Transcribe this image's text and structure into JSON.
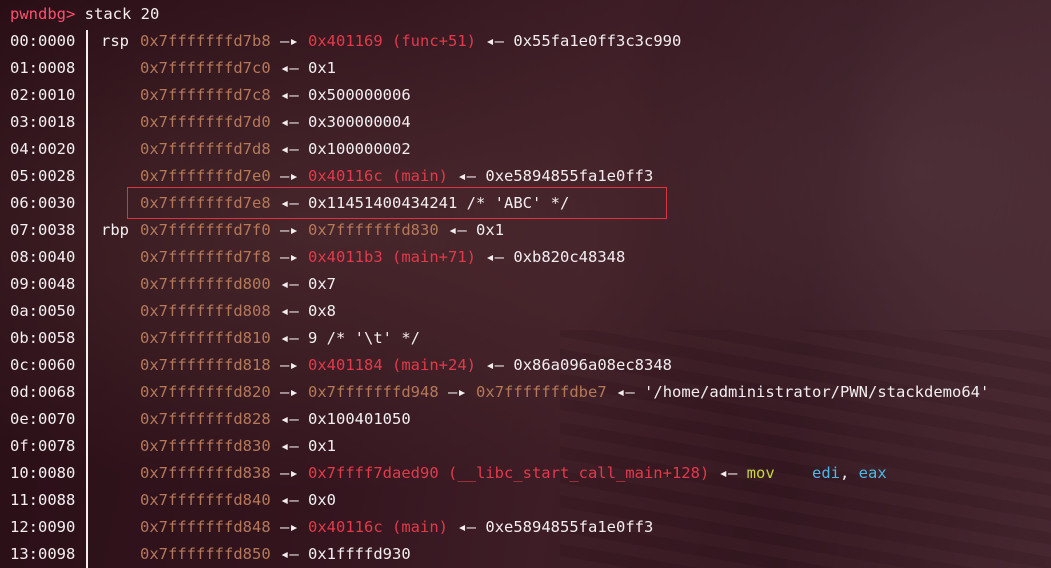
{
  "prompt": "pwndbg>",
  "command": "stack 20",
  "arrows": {
    "right": "—▸",
    "left": "◂—"
  },
  "rows": [
    {
      "idx": "00:0000",
      "reg": "rsp",
      "addr": "0x7fffffffd7b8",
      "a1": "—▸",
      "t1": "0x401169 (func+51)",
      "t1c": "code",
      "a2": "◂—",
      "t2": "0x55fa1e0ff3c3c990",
      "t2c": "val"
    },
    {
      "idx": "01:0008",
      "reg": "",
      "addr": "0x7fffffffd7c0",
      "a1": "◂—",
      "t1": "0x1",
      "t1c": "val"
    },
    {
      "idx": "02:0010",
      "reg": "",
      "addr": "0x7fffffffd7c8",
      "a1": "◂—",
      "t1": "0x500000006",
      "t1c": "val"
    },
    {
      "idx": "03:0018",
      "reg": "",
      "addr": "0x7fffffffd7d0",
      "a1": "◂—",
      "t1": "0x300000004",
      "t1c": "val"
    },
    {
      "idx": "04:0020",
      "reg": "",
      "addr": "0x7fffffffd7d8",
      "a1": "◂—",
      "t1": "0x100000002",
      "t1c": "val"
    },
    {
      "idx": "05:0028",
      "reg": "",
      "addr": "0x7fffffffd7e0",
      "a1": "—▸",
      "t1": "0x40116c (main)",
      "t1c": "code",
      "a2": "◂—",
      "t2": "0xe5894855fa1e0ff3",
      "t2c": "val"
    },
    {
      "idx": "06:0030",
      "reg": "",
      "addr": "0x7fffffffd7e8",
      "a1": "◂—",
      "t1": "0x11451400434241 /* 'ABC' */",
      "t1c": "val"
    },
    {
      "idx": "07:0038",
      "reg": "rbp",
      "addr": "0x7fffffffd7f0",
      "a1": "—▸",
      "t1": "0x7fffffffd830",
      "t1c": "addr",
      "a2": "◂—",
      "t2": "0x1",
      "t2c": "val"
    },
    {
      "idx": "08:0040",
      "reg": "",
      "addr": "0x7fffffffd7f8",
      "a1": "—▸",
      "t1": "0x4011b3 (main+71)",
      "t1c": "code",
      "a2": "◂—",
      "t2": "0xb820c48348",
      "t2c": "val"
    },
    {
      "idx": "09:0048",
      "reg": "",
      "addr": "0x7fffffffd800",
      "a1": "◂—",
      "t1": "0x7",
      "t1c": "val"
    },
    {
      "idx": "0a:0050",
      "reg": "",
      "addr": "0x7fffffffd808",
      "a1": "◂—",
      "t1": "0x8",
      "t1c": "val"
    },
    {
      "idx": "0b:0058",
      "reg": "",
      "addr": "0x7fffffffd810",
      "a1": "◂—",
      "t1": "9 /* '\\t' */",
      "t1c": "val"
    },
    {
      "idx": "0c:0060",
      "reg": "",
      "addr": "0x7fffffffd818",
      "a1": "—▸",
      "t1": "0x401184 (main+24)",
      "t1c": "code",
      "a2": "◂—",
      "t2": "0x86a096a08ec8348",
      "t2c": "val"
    },
    {
      "idx": "0d:0068",
      "reg": "",
      "addr": "0x7fffffffd820",
      "a1": "—▸",
      "t1": "0x7fffffffd948",
      "t1c": "addr",
      "a2": "—▸",
      "t2": "0x7fffffffdbe7",
      "t2c": "addr",
      "a3": "◂—",
      "t3": "'/home/administrator/PWN/stackdemo64'",
      "t3c": "val"
    },
    {
      "idx": "0e:0070",
      "reg": "",
      "addr": "0x7fffffffd828",
      "a1": "◂—",
      "t1": "0x100401050",
      "t1c": "val"
    },
    {
      "idx": "0f:0078",
      "reg": "",
      "addr": "0x7fffffffd830",
      "a1": "◂—",
      "t1": "0x1",
      "t1c": "val"
    },
    {
      "idx": "10:0080",
      "reg": "",
      "addr": "0x7fffffffd838",
      "a1": "—▸",
      "t1": "0x7ffff7daed90 (__libc_start_call_main+128)",
      "t1c": "code",
      "a2": "◂—",
      "asm": {
        "mnem": "mov",
        "ops": [
          {
            "t": "edi",
            "c": "asm-reg"
          },
          {
            "t": ", ",
            "c": "val"
          },
          {
            "t": "eax",
            "c": "asm-reg"
          }
        ]
      }
    },
    {
      "idx": "11:0088",
      "reg": "",
      "addr": "0x7fffffffd840",
      "a1": "◂—",
      "t1": "0x0",
      "t1c": "val"
    },
    {
      "idx": "12:0090",
      "reg": "",
      "addr": "0x7fffffffd848",
      "a1": "—▸",
      "t1": "0x40116c (main)",
      "t1c": "code",
      "a2": "◂—",
      "t2": "0xe5894855fa1e0ff3",
      "t2c": "val"
    },
    {
      "idx": "13:0098",
      "reg": "",
      "addr": "0x7fffffffd850",
      "a1": "◂—",
      "t1": "0x1ffffd930",
      "t1c": "val"
    }
  ],
  "colors": {
    "prompt": "#ff4f6e",
    "address": "#b5795a",
    "code": "#e23a4a",
    "value": "#f2eef0",
    "mnemonic": "#c7d83a",
    "register": "#4ab9e8",
    "highlight_box": "#d9343f"
  }
}
